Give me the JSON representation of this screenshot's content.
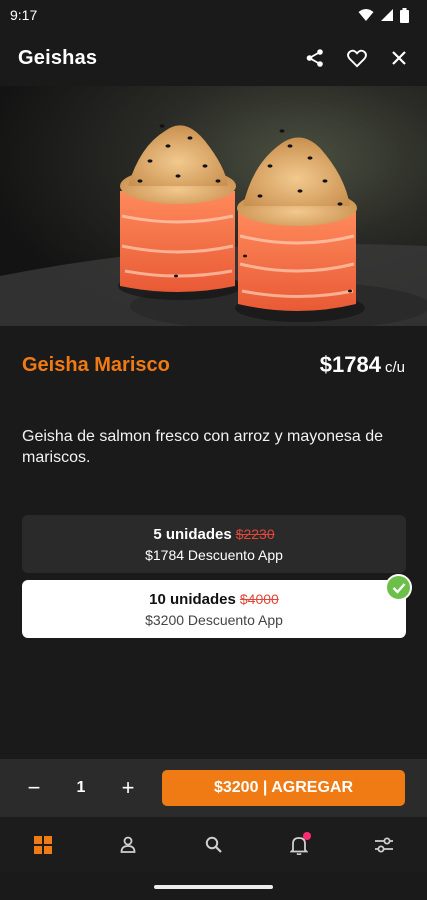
{
  "status_bar": {
    "time": "9:17"
  },
  "app_bar": {
    "title": "Geishas",
    "actions": [
      "share-icon",
      "heart-icon",
      "close-icon"
    ]
  },
  "product": {
    "name": "Geisha Marisco",
    "price": "$1784",
    "price_unit": "c/u",
    "description": "Geisha de salmon fresco con arroz y mayonesa de mariscos."
  },
  "options": [
    {
      "title": "5 unidades",
      "old_price": "$2230",
      "subtitle": "$1784 Descuento App",
      "selected": false
    },
    {
      "title": "10 unidades",
      "old_price": "$4000",
      "subtitle": "$3200 Descuento App",
      "selected": true
    }
  ],
  "cart": {
    "minus": "−",
    "quantity": "1",
    "plus": "+",
    "add_label": "$3200 | AGREGAR"
  },
  "colors": {
    "accent": "#f07a14",
    "strike": "#e0473a",
    "check": "#6cc04a",
    "notification": "#ff2d6f"
  },
  "bottom_nav": [
    "grid-icon",
    "user-icon",
    "search-icon",
    "bell-icon",
    "filters-icon"
  ]
}
